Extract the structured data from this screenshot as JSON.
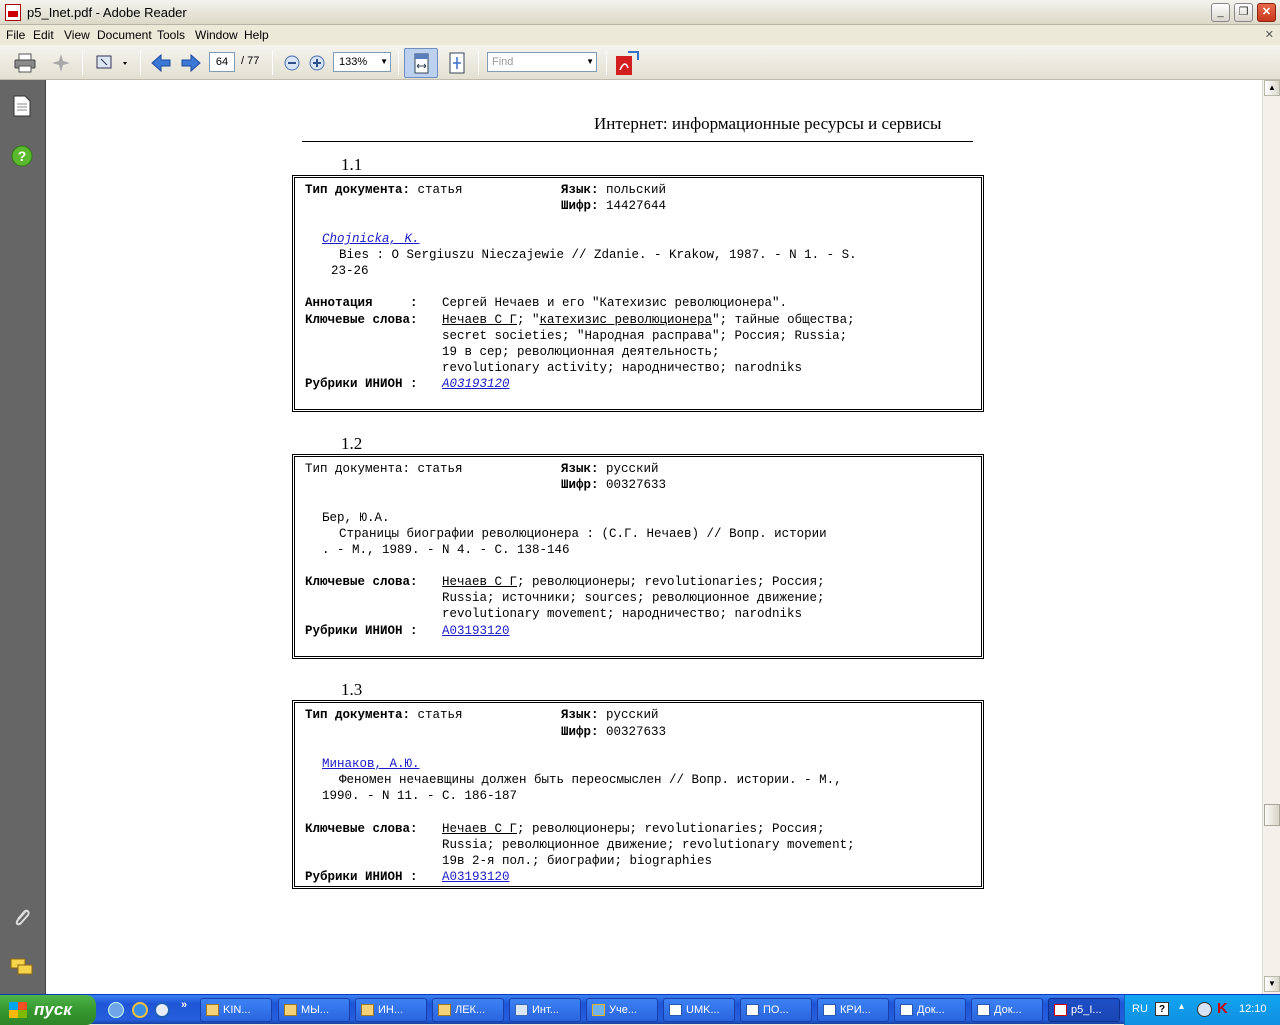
{
  "window": {
    "title": "p5_Inet.pdf - Adobe Reader"
  },
  "menu": [
    "File",
    "Edit",
    "View",
    "Document",
    "Tools",
    "Window",
    "Help"
  ],
  "toolbar": {
    "page_current": "64",
    "page_total": "/ 77",
    "zoom": "133%",
    "find_placeholder": "Find"
  },
  "document": {
    "header": "Интернет: информационные ресурсы и сервисы",
    "records": [
      {
        "num": "1.1",
        "type_label": "Тип документа:",
        "type_value": "статья",
        "lang_label": "Язык:",
        "lang_value": "польский",
        "code_label": "Шифр:",
        "code_value": "14427644",
        "author": "Chojnicka, K.",
        "title_line1": "Bies : O Sergiuszu Nieczajewie // Zdanie. - Krakow, 1987. - N 1. - S.",
        "title_line2": "23-26",
        "annot_label": "Аннотация     :",
        "annot_value": "Сергей Нечаев и его \"Катехизис революционера\".",
        "kw_label": "Ключевые слова:",
        "kw_line1_a": "Нечаев С Г",
        "kw_line1_b": "; \"",
        "kw_line1_c": "катехизис революционера",
        "kw_line1_d": "\"; тайные общества;",
        "kw_line2": "secret societies; \"Народная расправа\"; Россия; Russia;",
        "kw_line3": "19 в сер; революционная деятельность;",
        "kw_line4": "revolutionary activity; народничество; narodniks",
        "rub_label": "Рубрики ИНИОН :",
        "rub_value": "A03193120"
      },
      {
        "num": "1.2",
        "type_label": "Тип документа:",
        "type_value": "статья",
        "lang_label": "Язык:",
        "lang_value": "русский",
        "code_label": "Шифр:",
        "code_value": "00327633",
        "author": "Бер, Ю.А.",
        "title_line1": "Страницы биографии революционера : (С.Г. Нечаев) // Вопр. истории",
        "title_line2": ". - М., 1989. - N 4. - С. 138-146",
        "kw_label": "Ключевые слова:",
        "kw_line1_a": "Нечаев С Г",
        "kw_line1_b": "; революционеры; revolutionaries; Россия;",
        "kw_line2": "Russia; источники; sources; революционное движение;",
        "kw_line3": "revolutionary movement; народничество; narodniks",
        "rub_label": "Рубрики ИНИОН :",
        "rub_value": "A03193120"
      },
      {
        "num": "1.3",
        "type_label": "Тип документа:",
        "type_value": "статья",
        "lang_label": "Язык:",
        "lang_value": "русский",
        "code_label": "Шифр:",
        "code_value": "00327633",
        "author": "Минаков, А.Ю.",
        "title_line1": "Феномен нечаевщины должен быть переосмыслен // Вопр. истории. - М.,",
        "title_line2": "1990. - N 11. - С. 186-187",
        "kw_label": "Ключевые слова:",
        "kw_line1_a": "Нечаев С Г",
        "kw_line1_b": "; революционеры; revolutionaries; Россия;",
        "kw_line2": "Russia; революционное движение; revolutionary movement;",
        "kw_line3": "19в 2-я пол.; биографии; biographies",
        "rub_label": "Рубрики ИНИОН :",
        "rub_value": "A03193120"
      }
    ]
  },
  "taskbar": {
    "start": "пуск",
    "tasks": [
      "KIN...",
      "МЫ...",
      "ИН...",
      "ЛЕК...",
      "Инт...",
      "Уче...",
      "UMK...",
      "ПО...",
      "КРИ...",
      "Док...",
      "Док...",
      "p5_I..."
    ],
    "lang": "RU",
    "clock": "12:10"
  }
}
